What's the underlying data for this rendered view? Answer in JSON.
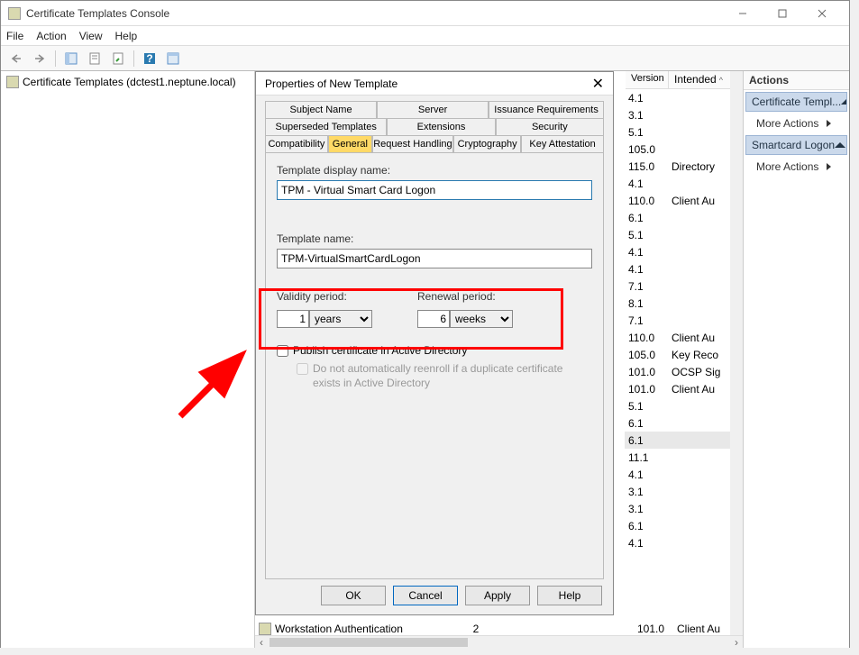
{
  "window": {
    "title": "Certificate Templates Console"
  },
  "menu": {
    "file": "File",
    "action": "Action",
    "view": "View",
    "help": "Help"
  },
  "tree": {
    "root": "Certificate Templates (dctest1.neptune.local)"
  },
  "list": {
    "col_version": "Version",
    "col_intended": "Intended",
    "rows": [
      {
        "v": "4.1",
        "i": ""
      },
      {
        "v": "3.1",
        "i": ""
      },
      {
        "v": "5.1",
        "i": ""
      },
      {
        "v": "105.0",
        "i": ""
      },
      {
        "v": "115.0",
        "i": "Directory"
      },
      {
        "v": "4.1",
        "i": ""
      },
      {
        "v": "110.0",
        "i": "Client Au"
      },
      {
        "v": "6.1",
        "i": ""
      },
      {
        "v": "5.1",
        "i": ""
      },
      {
        "v": "4.1",
        "i": ""
      },
      {
        "v": "4.1",
        "i": ""
      },
      {
        "v": "7.1",
        "i": ""
      },
      {
        "v": "8.1",
        "i": ""
      },
      {
        "v": "7.1",
        "i": ""
      },
      {
        "v": "110.0",
        "i": "Client Au"
      },
      {
        "v": "105.0",
        "i": "Key Reco"
      },
      {
        "v": "101.0",
        "i": "OCSP Sig"
      },
      {
        "v": "101.0",
        "i": "Client Au"
      },
      {
        "v": "5.1",
        "i": ""
      },
      {
        "v": "6.1",
        "i": ""
      },
      {
        "v": "6.1",
        "i": ""
      },
      {
        "v": "11.1",
        "i": ""
      },
      {
        "v": "4.1",
        "i": ""
      },
      {
        "v": "3.1",
        "i": ""
      },
      {
        "v": "3.1",
        "i": ""
      },
      {
        "v": "6.1",
        "i": ""
      },
      {
        "v": "4.1",
        "i": ""
      }
    ],
    "bottom": {
      "label": "Workstation Authentication",
      "num": "2",
      "ver": "101.0",
      "int": "Client Au"
    }
  },
  "actions": {
    "header": "Actions",
    "bar1": "Certificate Templ...",
    "item1": "More Actions",
    "bar2": "Smartcard Logon",
    "item2": "More Actions"
  },
  "dialog": {
    "title": "Properties of New Template",
    "tabs": {
      "subject": "Subject Name",
      "server": "Server",
      "issuance": "Issuance Requirements",
      "superseded": "Superseded Templates",
      "extensions": "Extensions",
      "security": "Security",
      "compat": "Compatibility",
      "general": "General",
      "request": "Request Handling",
      "crypto": "Cryptography",
      "keyatt": "Key Attestation"
    },
    "display_label": "Template display name:",
    "display_value": "TPM - Virtual Smart Card Logon",
    "name_label": "Template name:",
    "name_value": "TPM-VirtualSmartCardLogon",
    "validity_label": "Validity period:",
    "validity_value": "1",
    "validity_unit": "years",
    "renewal_label": "Renewal period:",
    "renewal_value": "6",
    "renewal_unit": "weeks",
    "publish": "Publish certificate in Active Directory",
    "publish_sub": "Do not automatically reenroll if a duplicate certificate exists in Active Directory",
    "ok": "OK",
    "cancel": "Cancel",
    "apply": "Apply",
    "help": "Help"
  }
}
